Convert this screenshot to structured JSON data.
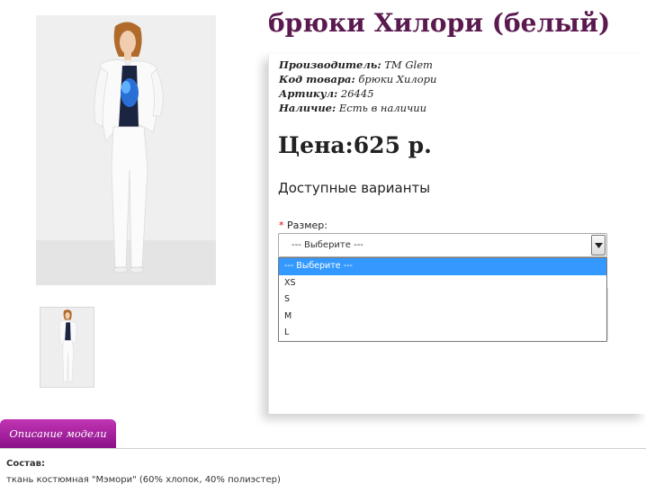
{
  "product": {
    "title": "брюки Хилори (белый)"
  },
  "meta": [
    {
      "label": "Производитель:",
      "value": "ТМ Glem"
    },
    {
      "label": "Код товара:",
      "value": "брюки Хилори"
    },
    {
      "label": "Артикул:",
      "value": "26445"
    },
    {
      "label": "Наличие:",
      "value": "Есть в наличии"
    }
  ],
  "price": {
    "text": "Цена:625 р."
  },
  "variants": {
    "heading": "Доступные варианты",
    "size_label": "Размер",
    "required_mark": "*",
    "colon": ":",
    "select_value": "--- Выберите ---",
    "options": [
      "--- Выберите ---",
      "XS",
      "S",
      "M",
      "L"
    ]
  },
  "tabs": {
    "description": "Описание модели"
  },
  "description": {
    "composition_label": "Состав:",
    "composition_text": "ткань костюмная \"Мэмори\" (60% хлопок, 40% полиэстер)"
  },
  "colors": {
    "title": "#5a1a4f",
    "tab": "#a020a0",
    "option_highlight": "#3399ff"
  }
}
